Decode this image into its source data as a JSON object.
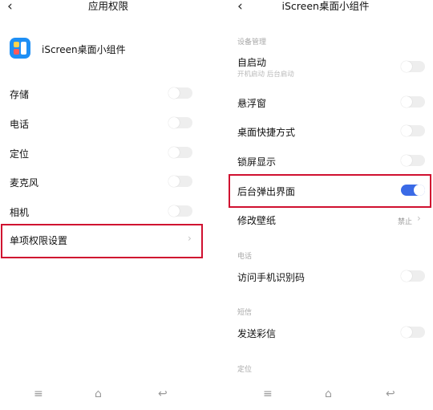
{
  "left": {
    "header": {
      "back_icon": "chevron-left-icon",
      "title": "应用权限"
    },
    "app": {
      "name": "iScreen桌面小组件",
      "icon": "app-icon"
    },
    "permissions": [
      {
        "label": "存储",
        "on": false
      },
      {
        "label": "电话",
        "on": false
      },
      {
        "label": "定位",
        "on": false
      },
      {
        "label": "麦克风",
        "on": false
      },
      {
        "label": "相机",
        "on": false
      }
    ],
    "single_perm": {
      "label": "单项权限设置",
      "icon": "chevron-right-icon"
    }
  },
  "right": {
    "header": {
      "back_icon": "chevron-left-icon",
      "title": "iScreen桌面小组件"
    },
    "section_device": "设备管理",
    "autostart": {
      "label": "自启动",
      "sub": "开机启动  后台启动",
      "on": false
    },
    "floating": {
      "label": "悬浮窗",
      "on": false
    },
    "shortcut": {
      "label": "桌面快捷方式",
      "on": false
    },
    "lockscreen": {
      "label": "锁屏显示",
      "on": false
    },
    "bg_popup": {
      "label": "后台弹出界面",
      "on": true
    },
    "wallpaper": {
      "label": "修改壁纸",
      "value": "禁止"
    },
    "section_phone": "电话",
    "phone_id": {
      "label": "访问手机识别码",
      "on": false
    },
    "section_sms": "短信",
    "mms": {
      "label": "发送彩信",
      "on": false
    },
    "section_location": "定位"
  },
  "nav": {
    "menu_icon": "≡",
    "home_icon": "⌂",
    "back_icon": "↩"
  },
  "colors": {
    "accent": "#3a6ae6",
    "highlight": "#d01030"
  }
}
